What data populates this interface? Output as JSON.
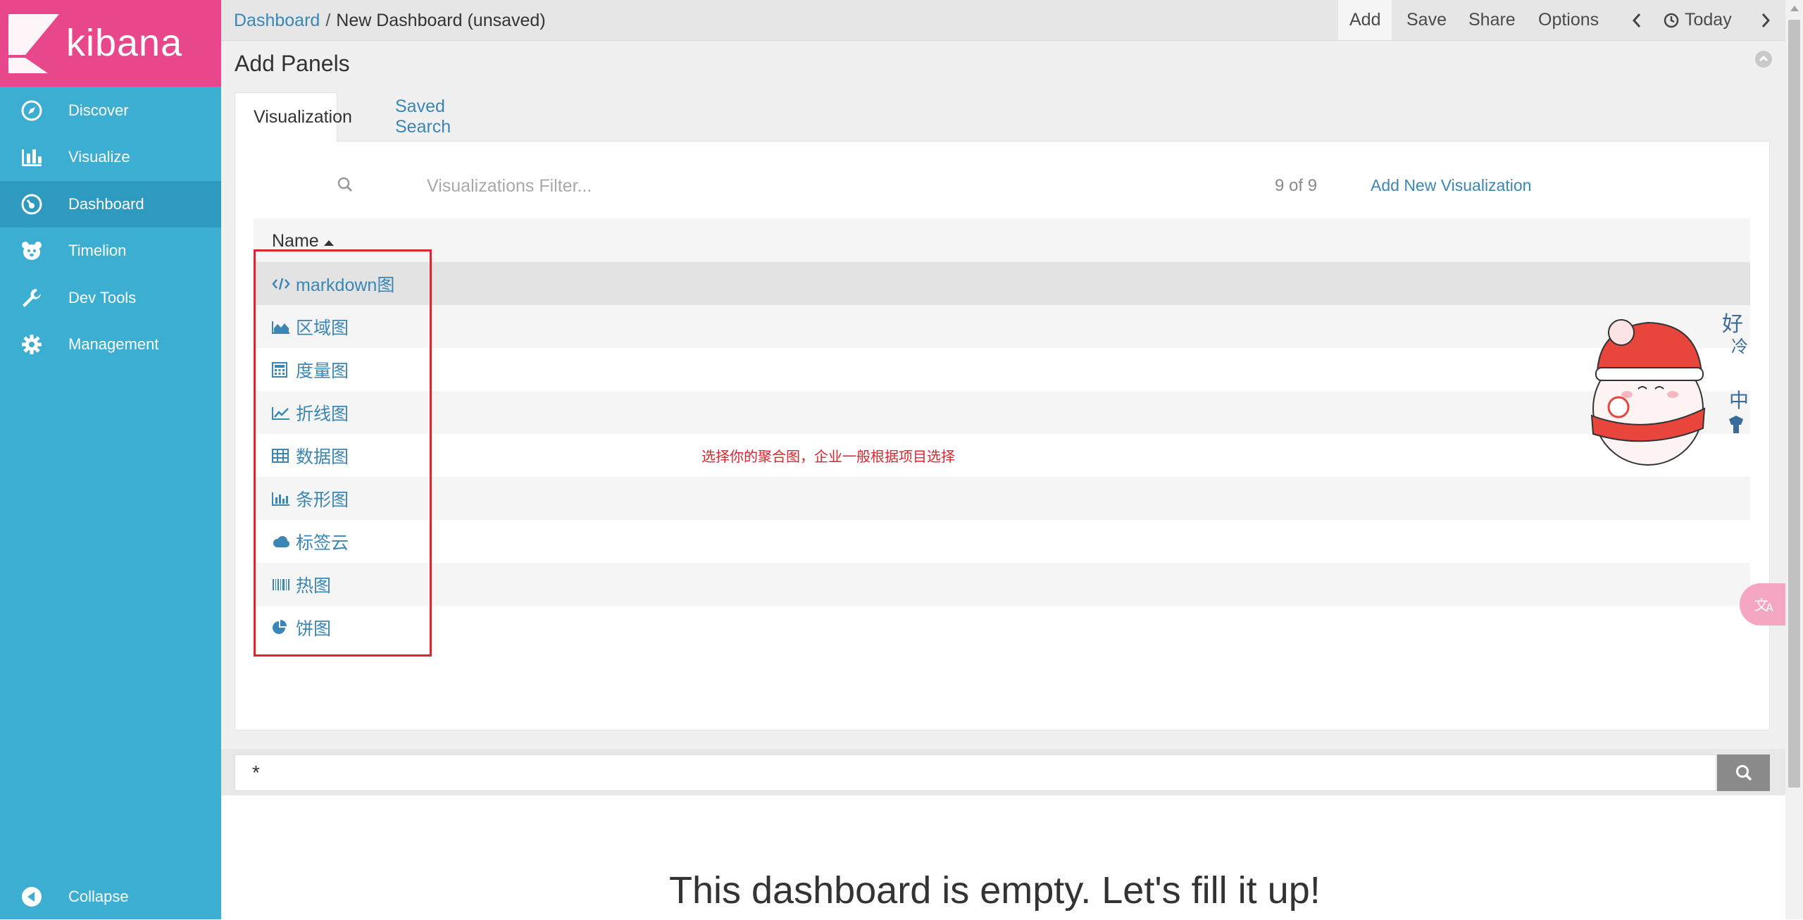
{
  "brand": {
    "name": "kibana",
    "color": "#e8488b"
  },
  "sidebar": {
    "items": [
      {
        "label": "Discover",
        "icon": "compass-icon"
      },
      {
        "label": "Visualize",
        "icon": "bar-chart-icon"
      },
      {
        "label": "Dashboard",
        "icon": "dashboard-gauge-icon",
        "active": true
      },
      {
        "label": "Timelion",
        "icon": "timelion-bear-icon"
      },
      {
        "label": "Dev Tools",
        "icon": "wrench-icon"
      },
      {
        "label": "Management",
        "icon": "gear-icon"
      }
    ],
    "collapse_label": "Collapse"
  },
  "topbar": {
    "breadcrumb_root": "Dashboard",
    "breadcrumb_sep": "/",
    "breadcrumb_current": "New Dashboard (unsaved)",
    "add": "Add",
    "save": "Save",
    "share": "Share",
    "options": "Options",
    "time": "Today"
  },
  "add_panels": {
    "title": "Add Panels",
    "tabs": [
      "Visualization",
      "Saved Search"
    ],
    "filter_placeholder": "Visualizations Filter...",
    "count": "9 of 9",
    "add_new": "Add New Visualization",
    "column_name": "Name",
    "rows": [
      {
        "label": "markdown图",
        "icon": "code-icon"
      },
      {
        "label": "区域图",
        "icon": "area-chart-icon"
      },
      {
        "label": "度量图",
        "icon": "calculator-icon"
      },
      {
        "label": "折线图",
        "icon": "line-chart-icon"
      },
      {
        "label": "数据图",
        "icon": "table-icon"
      },
      {
        "label": "条形图",
        "icon": "bar-chart-icon"
      },
      {
        "label": "标签云",
        "icon": "cloud-icon"
      },
      {
        "label": "热图",
        "icon": "barcode-icon"
      },
      {
        "label": "饼图",
        "icon": "pie-chart-icon"
      }
    ]
  },
  "annotation": "选择你的聚合图，企业一般根据项目选择",
  "query": {
    "value": "*"
  },
  "empty_message": "This dashboard is empty. Let's fill it up!",
  "sticker": {
    "text_top": "好",
    "text_mid": "冷",
    "text_bottom": "中"
  },
  "colors": {
    "sidebar": "#3caed2",
    "sidebar_active": "#2f9ac0",
    "link": "#3a86b4",
    "annotation": "#e0242e"
  }
}
